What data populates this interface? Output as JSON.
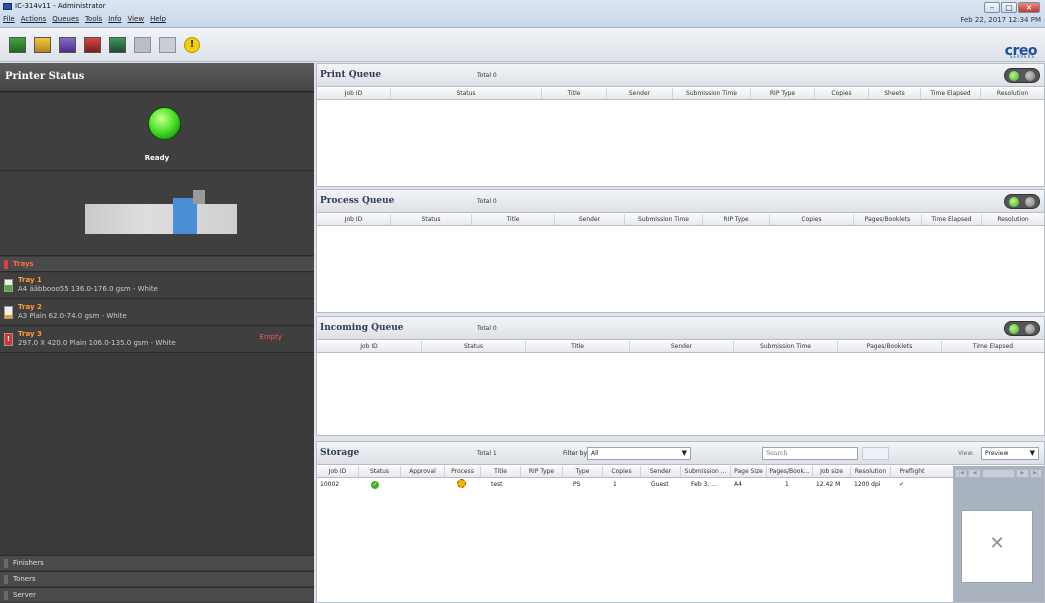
{
  "window": {
    "title": "IC-314v11 - Administrator",
    "datetime": "Feb 22, 2017 12:34 PM"
  },
  "menu": [
    "File",
    "Actions",
    "Queues",
    "Tools",
    "Info",
    "View",
    "Help"
  ],
  "logo": {
    "text": "creo",
    "subtext": "SERVERS"
  },
  "toolbar_alert": "!",
  "printer_status": {
    "header": "Printer Status",
    "status": "Ready",
    "trays_label": "Trays",
    "trays": [
      {
        "name": "Tray 1",
        "desc": "A4 ääbbooo55 136.0-176.0 gsm - White",
        "status": "",
        "level": 0.55
      },
      {
        "name": "Tray 2",
        "desc": "A3 Plain 62.0-74.0 gsm - White",
        "status": "",
        "level": 0.25
      },
      {
        "name": "Tray 3",
        "desc": "297.0 X 420.0 Plain 106.0-135.0 gsm - White",
        "status": "Empty",
        "level": 0
      }
    ],
    "footers": [
      "Finishers",
      "Toners",
      "Server"
    ],
    "tray3_icon": "!"
  },
  "print_queue": {
    "title": "Print Queue",
    "total": "Total 0",
    "columns": [
      "Job ID",
      "Status",
      "Title",
      "Sender",
      "Submission Time",
      "RIP Type",
      "Copies",
      "Sheets",
      "Time Elapsed",
      "Resolution"
    ]
  },
  "process_queue": {
    "title": "Process Queue",
    "total": "Total 0",
    "columns": [
      "Job ID",
      "Status",
      "Title",
      "Sender",
      "Submission Time",
      "RIP Type",
      "Copies",
      "Pages/Booklets",
      "Time Elapsed",
      "Resolution"
    ]
  },
  "incoming_queue": {
    "title": "Incoming Queue",
    "total": "Total 0",
    "columns": [
      "Job ID",
      "Status",
      "Title",
      "Sender",
      "Submission Time",
      "Pages/Booklets",
      "Time Elapsed"
    ]
  },
  "storage": {
    "title": "Storage",
    "total": "Total 1",
    "filter_label": "Filter by:",
    "filter_value": "All",
    "search_placeholder": "Search",
    "view_label": "View:",
    "view_value": "Preview",
    "columns": [
      "Job ID",
      "Status",
      "Approval",
      "Process",
      "Title",
      "RIP Type",
      "Type",
      "Copies",
      "Sender",
      "Submission ...",
      "Page Size",
      "Pages/Book...",
      "Job size",
      "Resolution",
      "Preflight"
    ],
    "rows": [
      {
        "job_id": "10002",
        "title": "test",
        "type": "PS",
        "copies": "1",
        "sender": "Guest",
        "submission": "Feb 3, ...",
        "page_size": "A4",
        "pages": "1",
        "job_size": "12.42 M",
        "resolution": "1200 dpi",
        "preflight": "✔"
      }
    ],
    "preview_placeholder": "✕"
  }
}
